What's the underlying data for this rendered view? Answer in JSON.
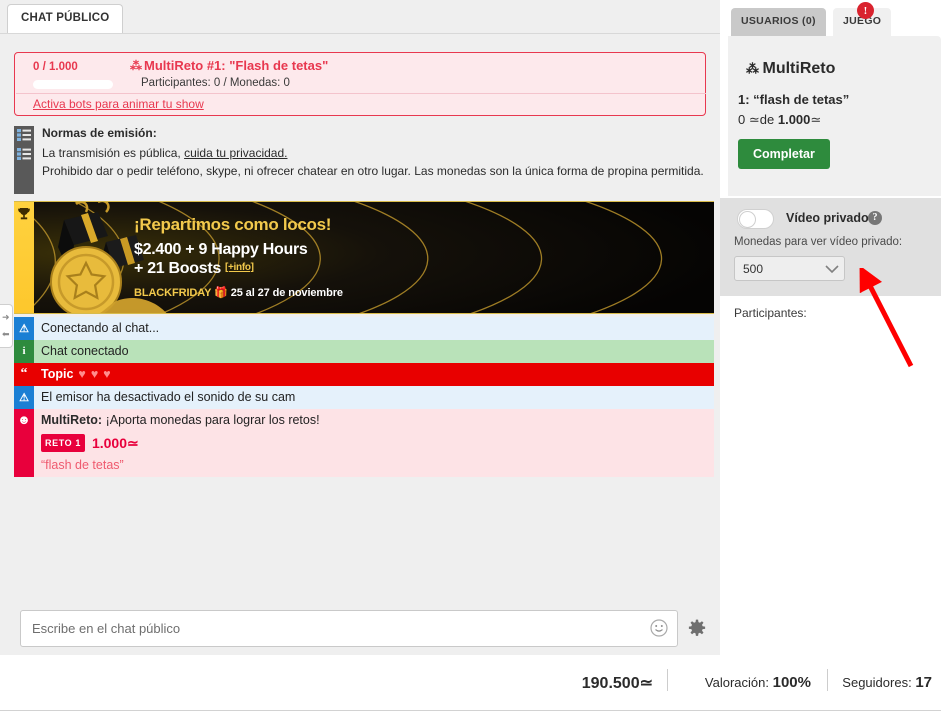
{
  "chat_panel": {
    "tab_label": "CHAT PÚBLICO",
    "reto": {
      "progress_text": "0 / 1.000",
      "progress_pct": 0,
      "icon": "trio-stars-icon",
      "title": "MultiReto #1: \"Flash de tetas\"",
      "stats": "Participantes: 0  /  Monedas: 0",
      "bots_link": "Activa bots para animar tu show"
    },
    "normas": {
      "icon": "list-icon",
      "heading": "Normas de emisión:",
      "line1_a": "La transmisión es pública, ",
      "line1_link": "cuida tu privacidad.",
      "line2": "Prohibido dar o pedir teléfono, skype, ni ofrecer chatear en otro lugar. Las monedas son la única forma de propina permitida."
    },
    "banner": {
      "icon": "trophy-icon",
      "line1": "¡Repartimos como locos!",
      "line2": "$2.400 + 9 Happy Hours",
      "line3": "+ 21 Boosts",
      "info_tag": "[+info]",
      "tag": "BLACKFRIDAY",
      "gift_icon": "gift-icon",
      "dates": "25 al 27 de noviembre"
    },
    "messages": [
      {
        "kind": "info",
        "icon": "warning-icon",
        "icon_glyph": "!",
        "icon_color": "#1b7fd4",
        "text": "Conectando al chat..."
      },
      {
        "kind": "ok",
        "icon": "info-icon",
        "icon_glyph": "i",
        "icon_color": "#2e8b3d",
        "text": "Chat conectado"
      },
      {
        "kind": "topic",
        "icon": "quote-icon",
        "icon_glyph": "“",
        "icon_color": "#e80000",
        "text": "Topic",
        "hearts": [
          "♥",
          "♥",
          "♥"
        ]
      },
      {
        "kind": "info",
        "icon": "warning-icon",
        "icon_glyph": "!",
        "icon_color": "#1b7fd4",
        "text": "El emisor ha desactivado el sonido de su cam"
      },
      {
        "kind": "reto",
        "icon": "smiley-icon",
        "icon_glyph": "☺",
        "icon_color": "#e8003c",
        "sender": "MultiReto:",
        "text": " ¡Aporta monedas para lograr los retos!",
        "badge": "RETO 1",
        "amount": "1.000",
        "quote": "“flash de tetas”"
      }
    ],
    "collapse_handle": {
      "right_arrow": "→",
      "left_arrow": "←"
    },
    "input": {
      "placeholder": "Escribe en el chat público",
      "value": "",
      "emoji_icon": "smiley-icon",
      "settings_icon": "gear-icon"
    }
  },
  "right_panel": {
    "tabs": [
      {
        "id": "usuarios",
        "label": "USUARIOS (0)",
        "active": false
      },
      {
        "id": "juego",
        "label": "JUEGO",
        "active": true,
        "badge": "!"
      }
    ],
    "game": {
      "icon": "trio-stars-icon",
      "title": "MultiReto",
      "challenge": "1: “flash de tetas”",
      "progress_current": "0",
      "progress_mid": "de",
      "progress_goal": "1.000",
      "coin_glyph": "≃",
      "complete_button": "Completar"
    },
    "private_video": {
      "toggle_on": false,
      "label": "Vídeo privado",
      "help_icon": "question-mark-icon",
      "sub_label": "Monedas para ver vídeo privado:",
      "selected": "500",
      "options": [
        "500"
      ],
      "chevron_icon": "chevron-down-icon"
    },
    "participants_label": "Participantes:",
    "avatar": "avatar"
  },
  "annotation": {
    "type": "arrow",
    "color": "#ff0000"
  },
  "footer": {
    "coins": "190.500",
    "coin_glyph": "≃",
    "rating_label": "Valoración:",
    "rating_value": "100%",
    "followers_label": "Seguidores:",
    "followers_value": "17"
  },
  "colors": {
    "accent_red": "#e8384f",
    "topic_red": "#e80000",
    "green": "#2e8b3d",
    "gold": "#f2c94c",
    "info_blue": "#1b7fd4"
  }
}
